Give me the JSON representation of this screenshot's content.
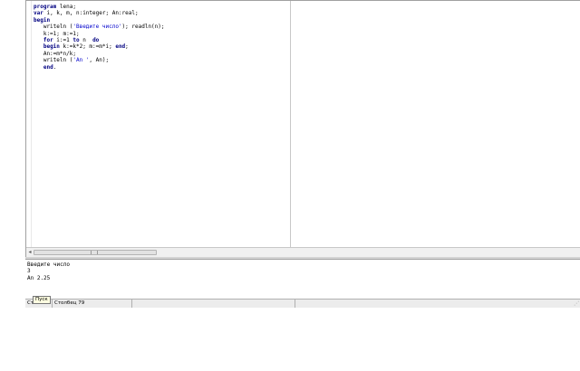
{
  "editor": {
    "lines": [
      [
        {
          "t": "program",
          "c": "kw"
        },
        {
          "t": " lena;"
        }
      ],
      [
        {
          "t": "var",
          "c": "kw"
        },
        {
          "t": " i, k, m, n:integer; An:real;"
        }
      ],
      [
        {
          "t": "begin",
          "c": "kw"
        }
      ],
      [
        {
          "t": "   writeln ("
        },
        {
          "t": "'Введите число'",
          "c": "str"
        },
        {
          "t": "); readln(n);"
        }
      ],
      [
        {
          "t": "   k:=1; m:=1;"
        }
      ],
      [
        {
          "t": "   "
        },
        {
          "t": "for",
          "c": "kw"
        },
        {
          "t": " i:=1 "
        },
        {
          "t": "to",
          "c": "kw"
        },
        {
          "t": " n  "
        },
        {
          "t": "do",
          "c": "kw"
        }
      ],
      [
        {
          "t": "   "
        },
        {
          "t": "begin",
          "c": "kw"
        },
        {
          "t": " k:=k*2; m:=m*i; "
        },
        {
          "t": "end",
          "c": "kw"
        },
        {
          "t": ";"
        }
      ],
      [
        {
          "t": "   An:=m*n/k;"
        }
      ],
      [
        {
          "t": "   writeln ("
        },
        {
          "t": "'An '",
          "c": "str"
        },
        {
          "t": ", An);"
        }
      ],
      [
        {
          "t": "   "
        },
        {
          "t": "end",
          "c": "kw"
        },
        {
          "t": "."
        }
      ]
    ]
  },
  "output": {
    "lines": [
      "Введите число",
      "3",
      "An 2.25"
    ]
  },
  "statusbar": {
    "line_label": "Ст",
    "column_label": "Столбец 79"
  },
  "tooltip": {
    "run_label": "Пуск"
  },
  "scrollbar": {
    "left_arrow": "◂"
  }
}
